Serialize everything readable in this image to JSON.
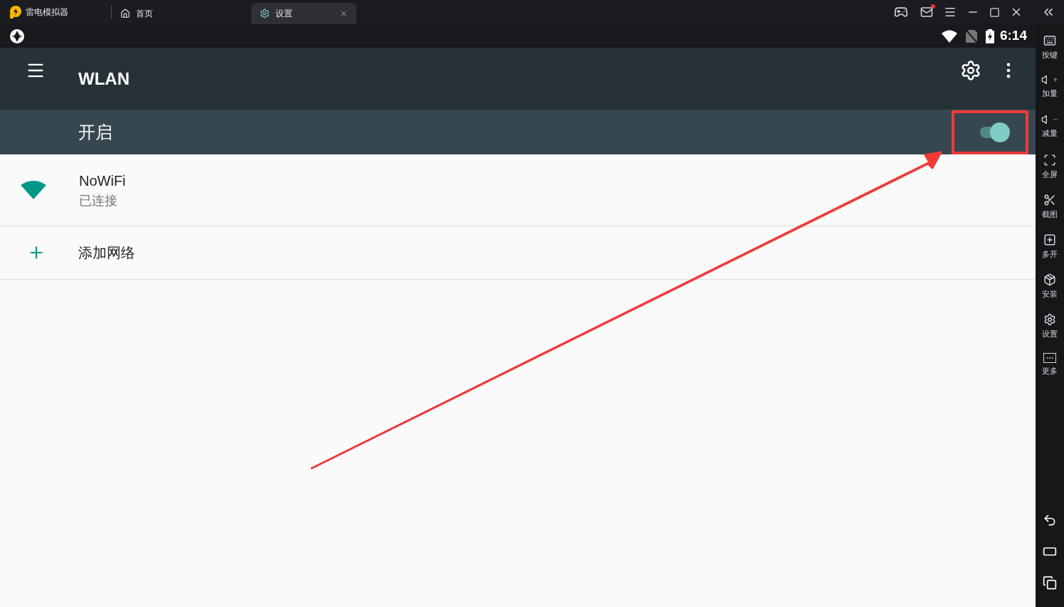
{
  "emulator": {
    "app_name": "雷电模拟器",
    "tabs": [
      {
        "label": "首页",
        "selected": false,
        "kind": "home"
      },
      {
        "label": "设置",
        "selected": true,
        "kind": "settings"
      }
    ]
  },
  "status_bar": {
    "time": "6:14"
  },
  "app_bar": {
    "title": "WLAN"
  },
  "master_switch": {
    "label": "开启",
    "on": true
  },
  "networks": [
    {
      "name": "NoWiFi",
      "status": "已连接"
    }
  ],
  "add_network": {
    "label": "添加网络"
  },
  "sidebar": {
    "items": [
      {
        "label": "按键",
        "kind": "keyboard"
      },
      {
        "label": "加量",
        "kind": "volume-up"
      },
      {
        "label": "减量",
        "kind": "volume-down"
      },
      {
        "label": "全屏",
        "kind": "fullscreen"
      },
      {
        "label": "截图",
        "kind": "screenshot"
      },
      {
        "label": "多开",
        "kind": "multi"
      },
      {
        "label": "安装",
        "kind": "install"
      },
      {
        "label": "设置",
        "kind": "settings"
      },
      {
        "label": "更多",
        "kind": "more"
      }
    ]
  }
}
